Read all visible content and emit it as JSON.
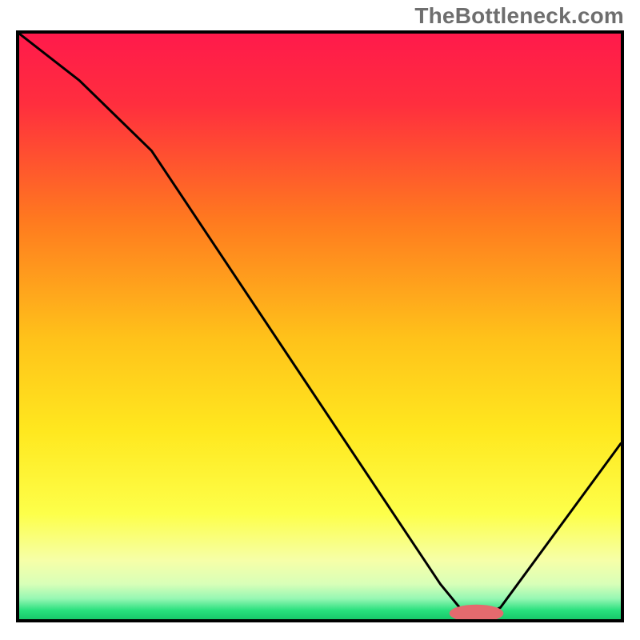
{
  "watermark": "TheBottleneck.com",
  "chart_data": {
    "type": "line",
    "title": "",
    "xlabel": "",
    "ylabel": "",
    "x_range": [
      0,
      100
    ],
    "y_range": [
      0,
      100
    ],
    "series": [
      {
        "name": "bottleneck-curve",
        "x": [
          0,
          10,
          22,
          70,
          74,
          78,
          80,
          100
        ],
        "y": [
          100,
          92,
          80,
          6,
          1,
          1,
          2,
          30
        ]
      }
    ],
    "gradient": {
      "stops": [
        {
          "offset": 0.0,
          "color": "#ff1a4b"
        },
        {
          "offset": 0.12,
          "color": "#ff2e3e"
        },
        {
          "offset": 0.32,
          "color": "#ff7a1f"
        },
        {
          "offset": 0.52,
          "color": "#ffc21a"
        },
        {
          "offset": 0.68,
          "color": "#ffe81f"
        },
        {
          "offset": 0.82,
          "color": "#fdff4a"
        },
        {
          "offset": 0.9,
          "color": "#f6ffa8"
        },
        {
          "offset": 0.94,
          "color": "#d8ffb8"
        },
        {
          "offset": 0.965,
          "color": "#95f7b3"
        },
        {
          "offset": 0.985,
          "color": "#28e07d"
        },
        {
          "offset": 1.0,
          "color": "#18c96a"
        }
      ]
    },
    "marker": {
      "name": "optimum-marker",
      "cx": 76,
      "cy": 1,
      "rx": 4.5,
      "ry": 1.5,
      "color": "#e46a6e"
    }
  }
}
